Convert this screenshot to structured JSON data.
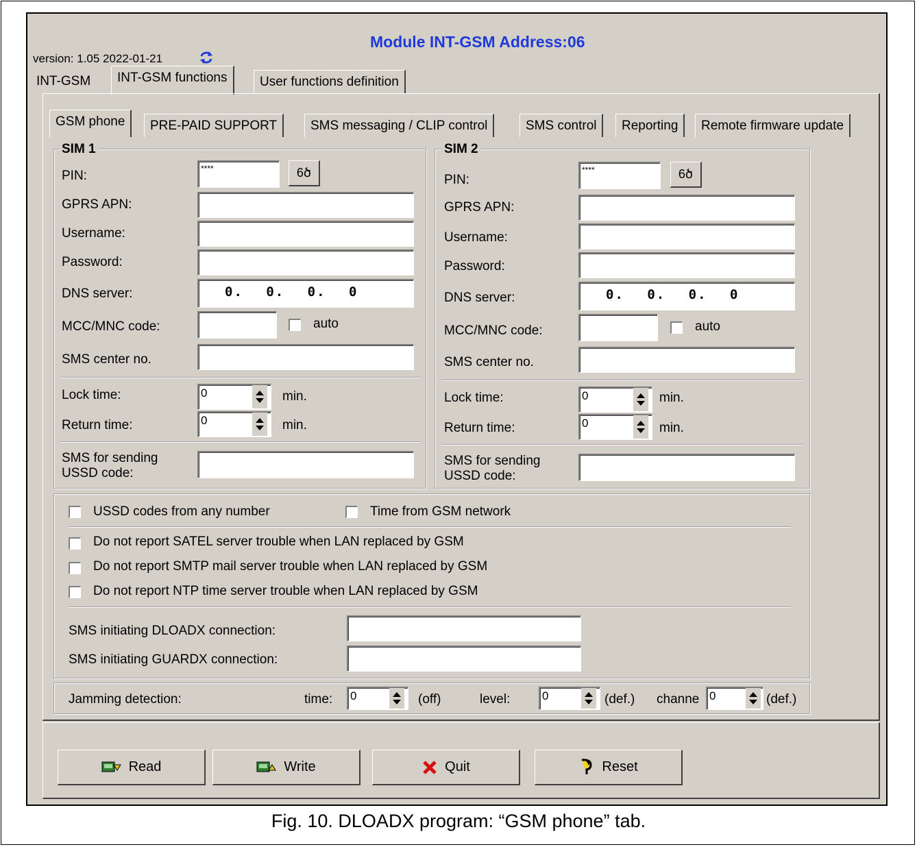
{
  "header": {
    "title": "Module INT-GSM Address:06",
    "version": "version: 1.05 2022-01-21"
  },
  "top_tabs": [
    "INT-GSM",
    "INT-GSM functions",
    "User functions definition"
  ],
  "sub_tabs": [
    "GSM phone",
    "PRE-PAID SUPPORT",
    "SMS messaging / CLIP control",
    "SMS control",
    "Reporting",
    "Remote firmware update"
  ],
  "sim1": {
    "title": "SIM 1",
    "pin_label": "PIN:",
    "pin_value": "****",
    "apn_label": "GPRS APN:",
    "apn_value": "",
    "username_label": "Username:",
    "username_value": "",
    "password_label": "Password:",
    "password_value": "",
    "dns_label": "DNS server:",
    "dns_value": "0. 0. 0. 0",
    "mcc_label": "MCC/MNC code:",
    "mcc_value": "",
    "auto_label": "auto",
    "smsc_label": "SMS center no.",
    "smsc_value": "",
    "lock_label": "Lock time:",
    "lock_value": "0",
    "lock_unit": "min.",
    "return_label": "Return time:",
    "return_value": "0",
    "return_unit": "min.",
    "ussd_label_1": "SMS for sending",
    "ussd_label_2": "USSD code:",
    "ussd_value": ""
  },
  "sim2": {
    "title": "SIM 2",
    "pin_label": "PIN:",
    "pin_value": "****",
    "apn_label": "GPRS APN:",
    "apn_value": "",
    "username_label": "Username:",
    "username_value": "",
    "password_label": "Password:",
    "password_value": "",
    "dns_label": "DNS server:",
    "dns_value": "0. 0. 0. 0",
    "mcc_label": "MCC/MNC code:",
    "mcc_value": "",
    "auto_label": "auto",
    "smsc_label": "SMS center no.",
    "smsc_value": "",
    "lock_label": "Lock time:",
    "lock_value": "0",
    "lock_unit": "min.",
    "return_label": "Return time:",
    "return_value": "0",
    "return_unit": "min.",
    "ussd_label_1": "SMS for sending",
    "ussd_label_2": "USSD code:",
    "ussd_value": ""
  },
  "options": {
    "ussd_any": "USSD codes from any number",
    "time_gsm": "Time from GSM network",
    "no_satel": "Do not report SATEL server trouble when LAN replaced by GSM",
    "no_smtp": "Do not report SMTP mail server trouble when LAN replaced by GSM",
    "no_ntp": "Do not report NTP time server trouble when LAN replaced by GSM",
    "dloadx_label": "SMS initiating DLOADX connection:",
    "dloadx_value": "",
    "guardx_label": "SMS initiating GUARDX connection:",
    "guardx_value": ""
  },
  "jamming": {
    "label": "Jamming detection:",
    "time_label": "time:",
    "time_value": "0",
    "time_note": "(off)",
    "level_label": "level:",
    "level_value": "0",
    "level_note": "(def.)",
    "channel_label": "channe",
    "channel_value": "0",
    "channel_note": "(def.)"
  },
  "buttons": {
    "read": "Read",
    "write": "Write",
    "quit": "Quit",
    "reset": "Reset"
  },
  "caption": "Fig. 10. DLOADX program: “GSM phone” tab."
}
